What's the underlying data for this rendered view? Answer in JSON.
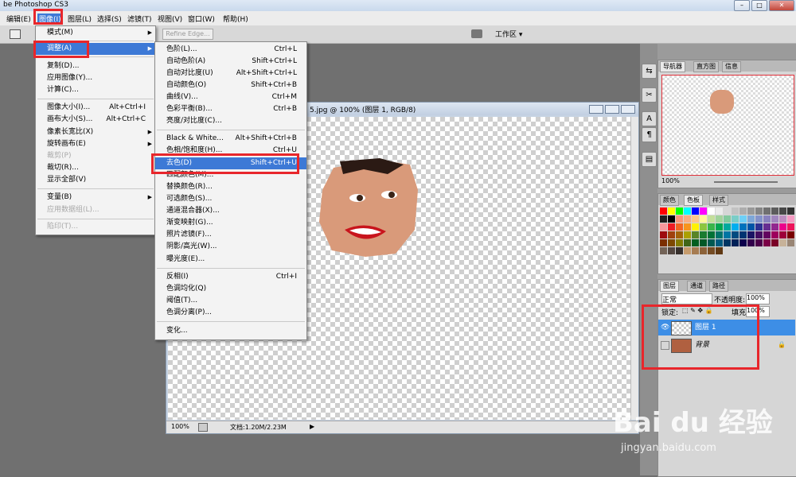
{
  "app": {
    "title": "be Photoshop CS3",
    "win_buttons": [
      "–",
      "□",
      "✕"
    ]
  },
  "menubar": [
    {
      "label": "编辑(E)"
    },
    {
      "label": "图像(I)"
    },
    {
      "label": "图层(L)"
    },
    {
      "label": "选择(S)"
    },
    {
      "label": "滤镜(T)"
    },
    {
      "label": "视图(V)"
    },
    {
      "label": "窗口(W)"
    },
    {
      "label": "帮助(H)"
    }
  ],
  "options": {
    "refine_edge": "Refine Edge...",
    "workspace": "工作区 ▾"
  },
  "image_menu": [
    {
      "label": "模式(M)",
      "arrow": true
    },
    {
      "label": "调整(A)",
      "arrow": true,
      "highlight": true
    },
    {
      "label": "复制(D)..."
    },
    {
      "label": "应用图像(Y)..."
    },
    {
      "label": "计算(C)..."
    },
    {
      "label": "图像大小(I)...",
      "shortcut": "Alt+Ctrl+I"
    },
    {
      "label": "画布大小(S)...",
      "shortcut": "Alt+Ctrl+C"
    },
    {
      "label": "像素长宽比(X)",
      "arrow": true
    },
    {
      "label": "旋转画布(E)",
      "arrow": true
    },
    {
      "label": "裁剪(P)",
      "disabled": true
    },
    {
      "label": "裁切(R)..."
    },
    {
      "label": "显示全部(V)"
    },
    {
      "label": "变量(B)",
      "arrow": true
    },
    {
      "label": "应用数据组(L)...",
      "disabled": true
    },
    {
      "label": "陷印(T)...",
      "disabled": true
    }
  ],
  "adjust_menu": [
    {
      "label": "色阶(L)...",
      "shortcut": "Ctrl+L"
    },
    {
      "label": "自动色阶(A)",
      "shortcut": "Shift+Ctrl+L"
    },
    {
      "label": "自动对比度(U)",
      "shortcut": "Alt+Shift+Ctrl+L"
    },
    {
      "label": "自动颜色(O)",
      "shortcut": "Shift+Ctrl+B"
    },
    {
      "label": "曲线(V)...",
      "shortcut": "Ctrl+M"
    },
    {
      "label": "色彩平衡(B)...",
      "shortcut": "Ctrl+B"
    },
    {
      "label": "亮度/对比度(C)..."
    },
    {
      "label": "Black & White...",
      "shortcut": "Alt+Shift+Ctrl+B"
    },
    {
      "label": "色相/饱和度(H)...",
      "shortcut": "Ctrl+U"
    },
    {
      "label": "去色(D)",
      "shortcut": "Shift+Ctrl+U",
      "highlight": true
    },
    {
      "label": "匹配颜色(M)..."
    },
    {
      "label": "替换颜色(R)..."
    },
    {
      "label": "可选颜色(S)..."
    },
    {
      "label": "通道混合器(X)..."
    },
    {
      "label": "渐变映射(G)..."
    },
    {
      "label": "照片滤镜(F)..."
    },
    {
      "label": "阴影/高光(W)..."
    },
    {
      "label": "曝光度(E)..."
    },
    {
      "label": "反相(I)",
      "shortcut": "Ctrl+I"
    },
    {
      "label": "色调均化(Q)"
    },
    {
      "label": "阈值(T)..."
    },
    {
      "label": "色调分离(P)..."
    },
    {
      "label": "变化..."
    }
  ],
  "document": {
    "title": "5.jpg @ 100% (图层 1, RGB/8)",
    "zoom": "100%",
    "doc_size": "文档:1.20M/2.23M"
  },
  "navigator": {
    "tabs": [
      "导航器",
      "直方图",
      "信息"
    ],
    "zoom": "100%"
  },
  "swatches": {
    "tabs": [
      "颜色",
      "色板",
      "样式"
    ],
    "colors": [
      "#ff0000",
      "#ffff00",
      "#00ff00",
      "#00ffff",
      "#0000ff",
      "#ff00ff",
      "#ffffff",
      "#ebebeb",
      "#d6d6d6",
      "#c2c2c2",
      "#adadad",
      "#999999",
      "#858585",
      "#707070",
      "#5c5c5c",
      "#474747",
      "#333333",
      "#1f1f1f",
      "#000000",
      "#f7977a",
      "#f9ad81",
      "#fdc68a",
      "#fff79a",
      "#c4df9b",
      "#a2d39c",
      "#82ca9d",
      "#7bcdc8",
      "#6ecff6",
      "#7ea7d8",
      "#8493ca",
      "#8882be",
      "#a187be",
      "#bc8dbf",
      "#f49ac2",
      "#f6989d",
      "#ed1c24",
      "#f26522",
      "#f7941d",
      "#fff200",
      "#8dc63f",
      "#39b54a",
      "#00a651",
      "#00a99d",
      "#00aeef",
      "#0072bc",
      "#0054a6",
      "#2e3192",
      "#662d91",
      "#92278f",
      "#ec008c",
      "#ed145b",
      "#9e0b0f",
      "#a0410d",
      "#a36209",
      "#aba000",
      "#598527",
      "#1a7b30",
      "#007236",
      "#00746b",
      "#0076a3",
      "#004b80",
      "#003471",
      "#1b1464",
      "#440e62",
      "#630460",
      "#9e005d",
      "#9e0039",
      "#790000",
      "#7b2e00",
      "#7d4900",
      "#827b00",
      "#406618",
      "#005e20",
      "#005826",
      "#005952",
      "#005b7f",
      "#003663",
      "#002157",
      "#0d004c",
      "#32004b",
      "#4b0049",
      "#7b0046",
      "#7a0026",
      "#c7b299",
      "#998675",
      "#736357",
      "#534741",
      "#37302d",
      "#c69c6d",
      "#a67c52",
      "#8c6239",
      "#754c24",
      "#603913"
    ]
  },
  "layers": {
    "tabs": [
      "图层",
      "通道",
      "路径"
    ],
    "blend_mode": "正常",
    "opacity_label": "不透明度:",
    "opacity": "100%",
    "lock_label": "锁定:",
    "fill_label": "填充:",
    "fill": "100%",
    "items": [
      {
        "name": "图层 1",
        "selected": true,
        "visible": true
      },
      {
        "name": "背景",
        "selected": false,
        "visible": false,
        "locked": true
      }
    ]
  },
  "watermark": {
    "brand": "Bai du 经验",
    "url": "jingyan.baidu.com"
  }
}
